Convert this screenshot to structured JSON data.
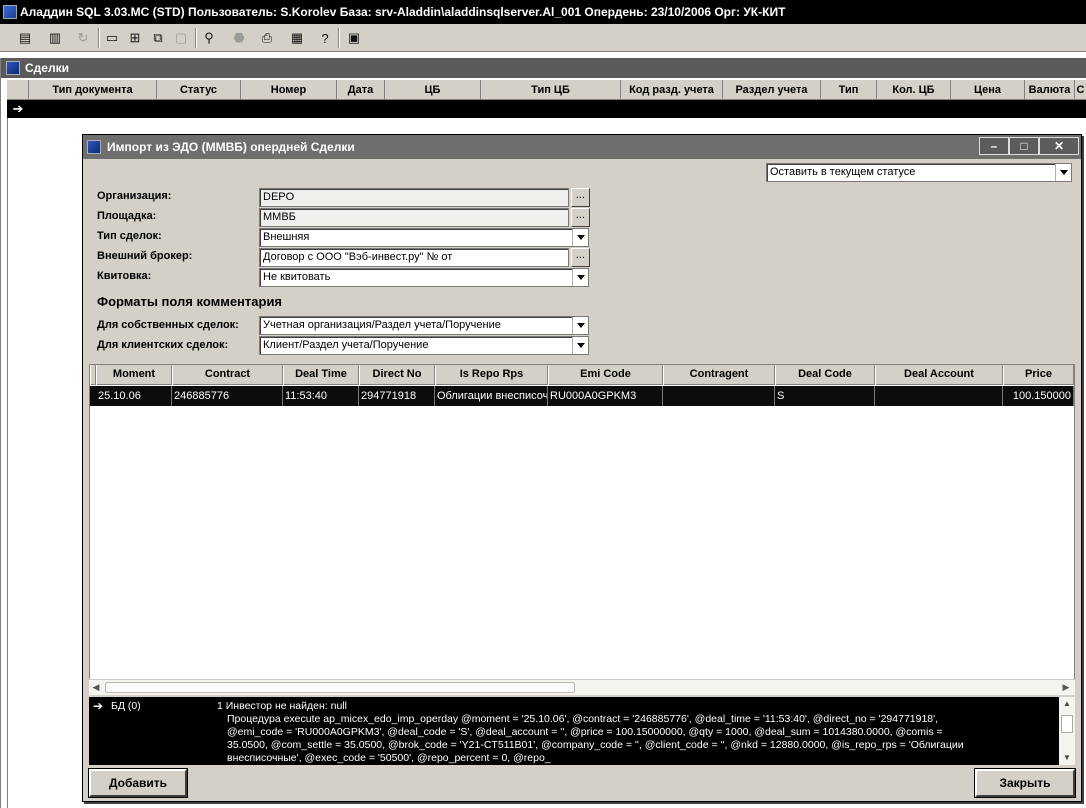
{
  "app": {
    "title": "Аладдин SQL 3.03.MC (STD)  Пользователь: S.Korolev База: srv-Aladdin\\aladdinsqlserver.Al_001 Опердень: 23/10/2006 Орг: УК-КИТ"
  },
  "toolbar": {
    "buttons": [
      "document-icon",
      "archive-icon",
      "refresh-icon",
      "window-icon",
      "tile-icon",
      "cascade-icon",
      "minimize-all-icon",
      "find-icon",
      "stop-icon",
      "print-icon",
      "export-icon",
      "help-icon",
      "settings-icon"
    ]
  },
  "deals_window": {
    "title": "Сделки",
    "columns": [
      "Тип документа",
      "Статус",
      "Номер",
      "Дата",
      "ЦБ",
      "Тип ЦБ",
      "Код разд. учета",
      "Раздел учета",
      "Тип",
      "Кол. ЦБ",
      "Цена",
      "Валюта",
      "С"
    ]
  },
  "dialog": {
    "title": "Импорт из ЭДО (ММВБ) опердней Сделки",
    "status_select": "Оставить в текущем статусе",
    "fields": {
      "org_label": "Организация:",
      "org_value": "DEPO",
      "venue_label": "Площадка:",
      "venue_value": "ММВБ",
      "deal_type_label": "Тип сделок:",
      "deal_type_value": "Внешняя",
      "broker_label": "Внешний брокер:",
      "broker_value": "Договор с ООО \"Вэб-инвест.ру\" №  от",
      "matching_label": "Квитовка:",
      "matching_value": "Не квитовать"
    },
    "comment_formats": {
      "title": "Форматы поля комментария",
      "own_label": "Для собственных сделок:",
      "own_value": "Учетная организация/Раздел учета/Поручение",
      "client_label": "Для клиентских сделок:",
      "client_value": "Клиент/Раздел учета/Поручение"
    },
    "grid": {
      "columns": [
        "Moment",
        "Contract",
        "Deal Time",
        "Direct No",
        "Is Repo Rps",
        "Emi Code",
        "Contragent",
        "Deal Code",
        "Deal Account",
        "Price"
      ],
      "rows": [
        [
          "25.10.06",
          "246885776",
          "11:53:40",
          "294771918",
          "Облигации внесписоч",
          "RU000A0GPKM3",
          "",
          "S",
          "",
          "100.150000"
        ]
      ]
    },
    "log": {
      "source": "БД (0)",
      "lines": [
        "1 Инвестор не найден: null",
        "Процедура execute ap_micex_edo_imp_operday @moment = '25.10.06', @contract = '246885776', @deal_time = '11:53:40', @direct_no = '294771918',",
        "@emi_code = 'RU000A0GPKM3', @deal_code = 'S', @deal_account = '', @price = 100.15000000, @qty = 1000, @deal_sum = 1014380.0000, @comis =",
        "35.0500, @com_settle = 35.0500, @brok_code = 'Y21-CT511B01', @company_code = '', @client_code = '', @nkd = 12880.0000, @is_repo_rps = 'Облигации",
        "внесписочные', @exec_code = '50500', @repo_percent = 0, @repo_"
      ]
    },
    "buttons": {
      "add": "Добавить",
      "close": "Закрыть"
    }
  }
}
